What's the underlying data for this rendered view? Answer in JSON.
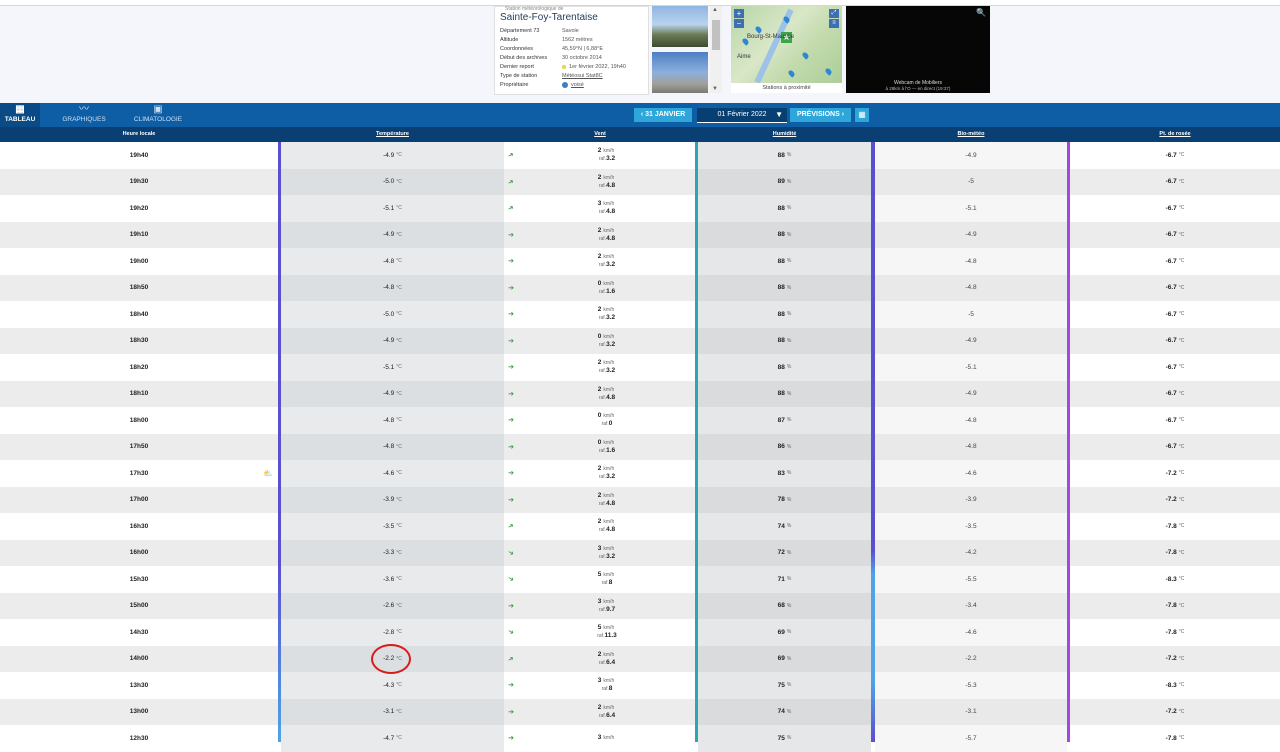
{
  "station": {
    "subtitle": "Station météorologique de",
    "title": "Sainte-Foy-Tarentaise",
    "info": [
      {
        "k": "Département 73",
        "v": "Savoie"
      },
      {
        "k": "Altitude",
        "v": "1562 mètres"
      },
      {
        "k": "Coordonnées",
        "v": "45,59°N | 6,88°E"
      },
      {
        "k": "Début des archives",
        "v": "30 octobre 2014"
      },
      {
        "k": "Dernier report",
        "v": "1er février 2022, 19h40"
      },
      {
        "k": "Type de station",
        "v": "Météosui Stat8C"
      },
      {
        "k": "Propriétaire",
        "v": "voisé"
      }
    ]
  },
  "map": {
    "caption": "Stations à proximité",
    "place1": "Bourg-St-Maurice",
    "place2": "Aime",
    "zoom_in": "+",
    "zoom_out": "−"
  },
  "webcam": {
    "title": "Webcam de Mobiliers",
    "sub": "à 28km à l'O — en direct (19:37)"
  },
  "nav": {
    "tabs": [
      {
        "label": "TABLEAU",
        "icon": "grid-icon"
      },
      {
        "label": "GRAPHIQUES",
        "icon": "chart-icon"
      },
      {
        "label": "CLIMATOLOGIE",
        "icon": "calendar-icon"
      }
    ],
    "prev": "31 JANVIER",
    "date": "01 Février 2022",
    "next": "PRÉVISIONS"
  },
  "headers": [
    "Heure locale",
    "Température",
    "Vent",
    "Humidité",
    "Bio-météo",
    "Pt. de rosée"
  ],
  "units": {
    "temp": "°C",
    "wind": "km/h",
    "raf": "raf.",
    "hum": "%"
  },
  "rows": [
    {
      "h": "19h40",
      "t": "-4.9",
      "w": "2",
      "r": "3.2",
      "hu": "88",
      "m": "-4.9",
      "d": "-6.7"
    },
    {
      "h": "19h30",
      "t": "-5.0",
      "w": "2",
      "r": "4.8",
      "hu": "89",
      "m": "-5",
      "d": "-6.7"
    },
    {
      "h": "19h20",
      "t": "-5.1",
      "w": "3",
      "r": "4.8",
      "hu": "88",
      "m": "-5.1",
      "d": "-6.7"
    },
    {
      "h": "19h10",
      "t": "-4.9",
      "w": "2",
      "r": "4.8",
      "hu": "88",
      "m": "-4.9",
      "d": "-6.7"
    },
    {
      "h": "19h00",
      "t": "-4.8",
      "w": "2",
      "r": "3.2",
      "hu": "88",
      "m": "-4.8",
      "d": "-6.7"
    },
    {
      "h": "18h50",
      "t": "-4.8",
      "w": "0",
      "r": "1.6",
      "hu": "88",
      "m": "-4.8",
      "d": "-6.7"
    },
    {
      "h": "18h40",
      "t": "-5.0",
      "w": "2",
      "r": "3.2",
      "hu": "88",
      "m": "-5",
      "d": "-6.7"
    },
    {
      "h": "18h30",
      "t": "-4.9",
      "w": "0",
      "r": "3.2",
      "hu": "88",
      "m": "-4.9",
      "d": "-6.7"
    },
    {
      "h": "18h20",
      "t": "-5.1",
      "w": "2",
      "r": "3.2",
      "hu": "88",
      "m": "-5.1",
      "d": "-6.7"
    },
    {
      "h": "18h10",
      "t": "-4.9",
      "w": "2",
      "r": "4.8",
      "hu": "88",
      "m": "-4.9",
      "d": "-6.7"
    },
    {
      "h": "18h00",
      "t": "-4.8",
      "w": "0",
      "r": "0",
      "hu": "87",
      "m": "-4.8",
      "d": "-6.7"
    },
    {
      "h": "17h50",
      "t": "-4.8",
      "w": "0",
      "r": "1.6",
      "hu": "86",
      "m": "-4.8",
      "d": "-6.7"
    },
    {
      "h": "17h30",
      "t": "-4.6",
      "w": "2",
      "r": "3.2",
      "hu": "83",
      "m": "-4.6",
      "d": "-7.2"
    },
    {
      "h": "17h00",
      "t": "-3.9",
      "w": "2",
      "r": "4.8",
      "hu": "78",
      "m": "-3.9",
      "d": "-7.2"
    },
    {
      "h": "16h30",
      "t": "-3.5",
      "w": "2",
      "r": "4.8",
      "hu": "74",
      "m": "-3.5",
      "d": "-7.8"
    },
    {
      "h": "16h00",
      "t": "-3.3",
      "w": "3",
      "r": "3.2",
      "hu": "72",
      "m": "-4.2",
      "d": "-7.8"
    },
    {
      "h": "15h30",
      "t": "-3.6",
      "w": "5",
      "r": "8",
      "hu": "71",
      "m": "-5.5",
      "d": "-8.3"
    },
    {
      "h": "15h00",
      "t": "-2.6",
      "w": "3",
      "r": "9.7",
      "hu": "68",
      "m": "-3.4",
      "d": "-7.8"
    },
    {
      "h": "14h30",
      "t": "-2.8",
      "w": "5",
      "r": "11.3",
      "hu": "69",
      "m": "-4.6",
      "d": "-7.8"
    },
    {
      "h": "14h00",
      "t": "-2.2",
      "w": "2",
      "r": "6.4",
      "hu": "69",
      "m": "-2.2",
      "d": "-7.2"
    },
    {
      "h": "13h30",
      "t": "-4.3",
      "w": "3",
      "r": "8",
      "hu": "75",
      "m": "-5.3",
      "d": "-8.3"
    },
    {
      "h": "13h00",
      "t": "-3.1",
      "w": "2",
      "r": "6.4",
      "hu": "74",
      "m": "-3.1",
      "d": "-7.2"
    },
    {
      "h": "12h30",
      "t": "-4.7",
      "w": "3",
      "r": "",
      "hu": "75",
      "m": "-5.7",
      "d": "-7.8"
    }
  ]
}
